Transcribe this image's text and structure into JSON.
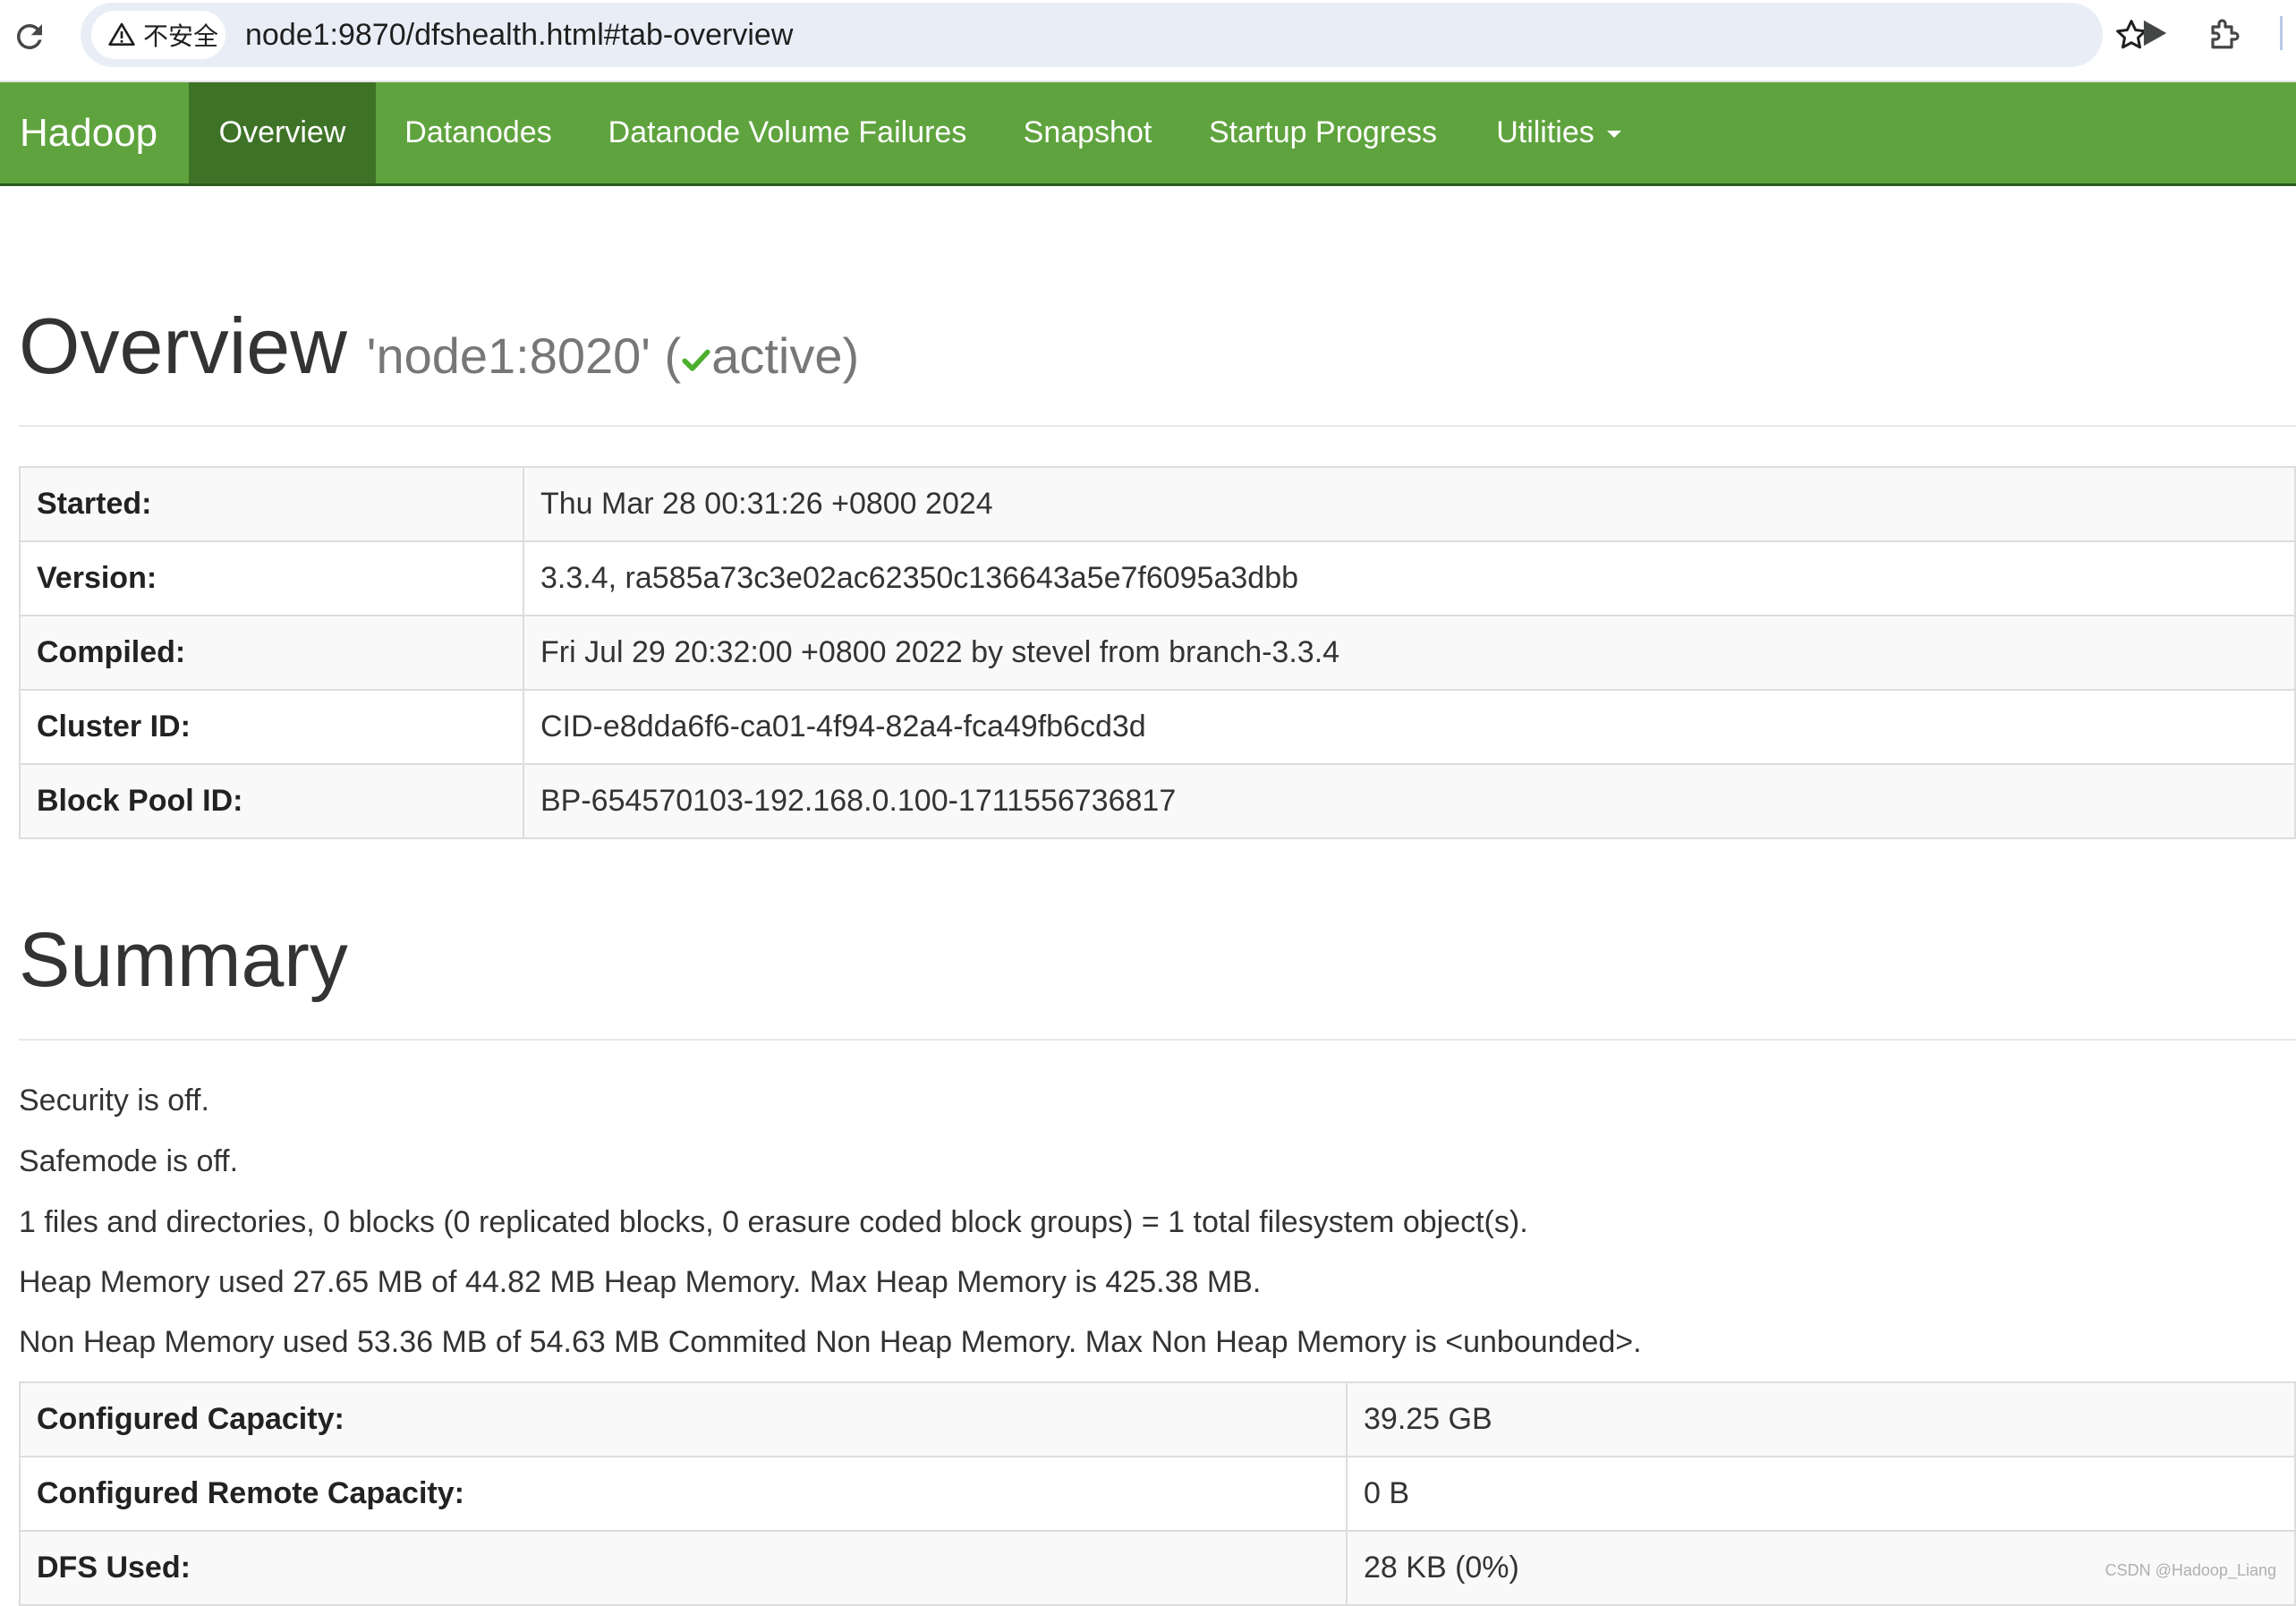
{
  "browser": {
    "insecure_label": "不安全",
    "url": "node1:9870/dfshealth.html#tab-overview"
  },
  "navbar": {
    "brand": "Hadoop",
    "items": [
      {
        "label": "Overview",
        "active": true
      },
      {
        "label": "Datanodes"
      },
      {
        "label": "Datanode Volume Failures"
      },
      {
        "label": "Snapshot"
      },
      {
        "label": "Startup Progress"
      },
      {
        "label": "Utilities",
        "dropdown": true
      }
    ]
  },
  "overview": {
    "title": "Overview",
    "node": "'node1:8020' (",
    "status": "active)",
    "status_icon": "check-icon",
    "rows": [
      {
        "label": "Started:",
        "value": "Thu Mar 28 00:31:26 +0800 2024"
      },
      {
        "label": "Version:",
        "value": "3.3.4, ra585a73c3e02ac62350c136643a5e7f6095a3dbb"
      },
      {
        "label": "Compiled:",
        "value": "Fri Jul 29 20:32:00 +0800 2022 by stevel from branch-3.3.4"
      },
      {
        "label": "Cluster ID:",
        "value": "CID-e8dda6f6-ca01-4f94-82a4-fca49fb6cd3d"
      },
      {
        "label": "Block Pool ID:",
        "value": "BP-654570103-192.168.0.100-1711556736817"
      }
    ]
  },
  "summary": {
    "title": "Summary",
    "lines": [
      "Security is off.",
      "Safemode is off.",
      "1 files and directories, 0 blocks (0 replicated blocks, 0 erasure coded block groups) = 1 total filesystem object(s).",
      "Heap Memory used 27.65 MB of 44.82 MB Heap Memory. Max Heap Memory is 425.38 MB.",
      "Non Heap Memory used 53.36 MB of 54.63 MB Commited Non Heap Memory. Max Non Heap Memory is <unbounded>."
    ],
    "rows": [
      {
        "label": "Configured Capacity:",
        "value": "39.25 GB"
      },
      {
        "label": "Configured Remote Capacity:",
        "value": "0 B"
      },
      {
        "label": "DFS Used:",
        "value": "28 KB (0%)"
      }
    ]
  },
  "watermark": "CSDN @Hadoop_Liang",
  "colors": {
    "navbar": "#5fa33e",
    "navbar_active": "#3e7327",
    "navbar_border": "#2d5a1d",
    "status_check": "#4caf2f"
  }
}
